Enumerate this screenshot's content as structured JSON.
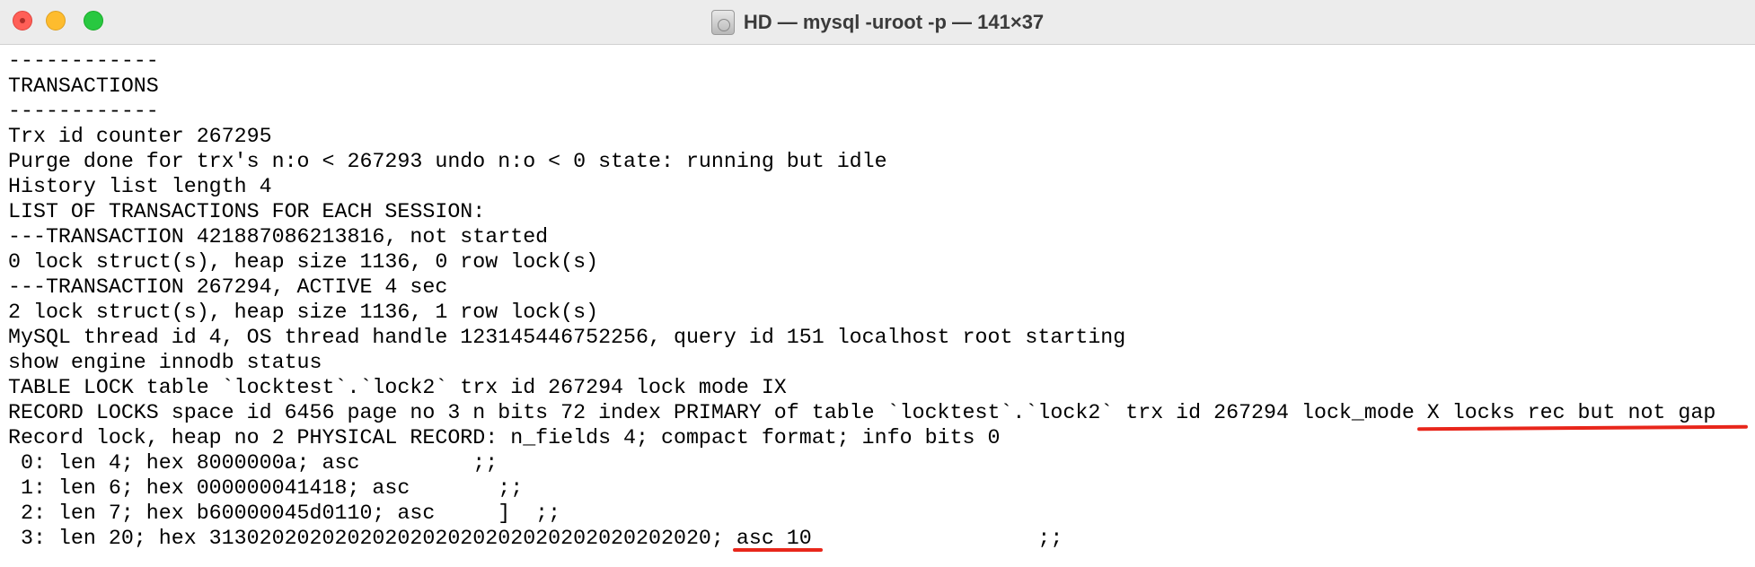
{
  "window": {
    "title": "HD — mysql -uroot -p — 141×37",
    "icon": "hard-disk-icon"
  },
  "terminal": {
    "lines": [
      "------------",
      "TRANSACTIONS",
      "------------",
      "Trx id counter 267295",
      "Purge done for trx's n:o < 267293 undo n:o < 0 state: running but idle",
      "History list length 4",
      "LIST OF TRANSACTIONS FOR EACH SESSION:",
      "---TRANSACTION 421887086213816, not started",
      "0 lock struct(s), heap size 1136, 0 row lock(s)",
      "---TRANSACTION 267294, ACTIVE 4 sec",
      "2 lock struct(s), heap size 1136, 1 row lock(s)",
      "MySQL thread id 4, OS thread handle 123145446752256, query id 151 localhost root starting",
      "show engine innodb status",
      "TABLE LOCK table `locktest`.`lock2` trx id 267294 lock mode IX",
      "RECORD LOCKS space id 6456 page no 3 n bits 72 index PRIMARY of table `locktest`.`lock2` trx id 267294 lock_mode X locks rec but not gap",
      "Record lock, heap no 2 PHYSICAL RECORD: n_fields 4; compact format; info bits 0",
      " 0: len 4; hex 8000000a; asc         ;;",
      " 1: len 6; hex 000000041418; asc       ;;",
      " 2: len 7; hex b60000045d0110; asc     ]  ;;",
      " 3: len 20; hex 3130202020202020202020202020202020202020; asc 10                  ;;"
    ]
  },
  "annotations": {
    "color": "#e8261b"
  }
}
